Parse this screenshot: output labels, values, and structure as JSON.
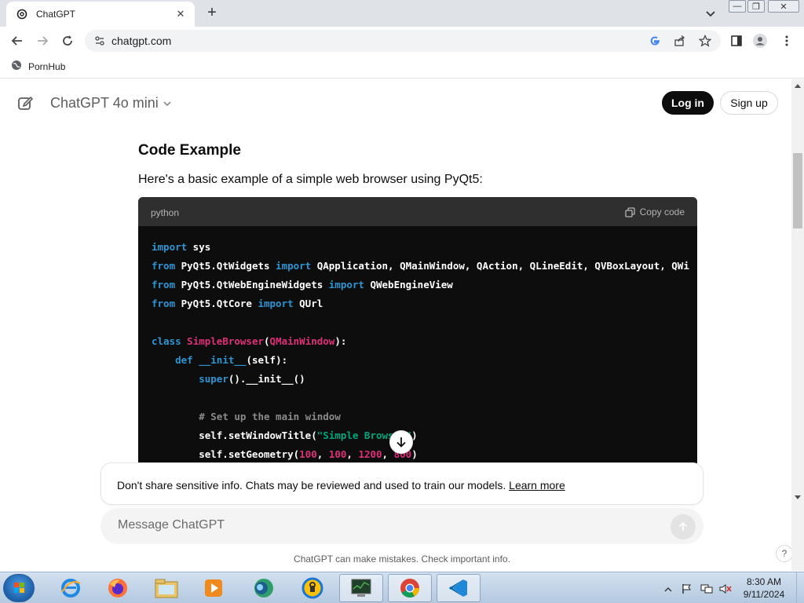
{
  "browser": {
    "tab_title": "ChatGPT",
    "url": "chatgpt.com",
    "bookmark_label": "PornHub"
  },
  "header": {
    "model_name": "ChatGPT 4o mini",
    "login_label": "Log in",
    "signup_label": "Sign up"
  },
  "content": {
    "heading": "Code Example",
    "paragraph": "Here's a basic example of a simple web browser using PyQt5:"
  },
  "code_block": {
    "language": "python",
    "copy_label": "Copy code",
    "lines": [
      [
        {
          "t": "import",
          "c": "kw"
        },
        {
          "t": " sys",
          "c": ""
        }
      ],
      [
        {
          "t": "from",
          "c": "kw"
        },
        {
          "t": " PyQt5.QtWidgets ",
          "c": ""
        },
        {
          "t": "import",
          "c": "kw"
        },
        {
          "t": " QApplication, QMainWindow, QAction, QLineEdit, QVBoxLayout, QWi",
          "c": ""
        }
      ],
      [
        {
          "t": "from",
          "c": "kw"
        },
        {
          "t": " PyQt5.QtWebEngineWidgets ",
          "c": ""
        },
        {
          "t": "import",
          "c": "kw"
        },
        {
          "t": " QWebEngineView",
          "c": ""
        }
      ],
      [
        {
          "t": "from",
          "c": "kw"
        },
        {
          "t": " PyQt5.QtCore ",
          "c": ""
        },
        {
          "t": "import",
          "c": "kw"
        },
        {
          "t": " QUrl",
          "c": ""
        }
      ],
      [],
      [
        {
          "t": "class",
          "c": "kw"
        },
        {
          "t": " ",
          "c": ""
        },
        {
          "t": "SimpleBrowser",
          "c": "cls"
        },
        {
          "t": "(",
          "c": ""
        },
        {
          "t": "QMainWindow",
          "c": "cls"
        },
        {
          "t": "):",
          "c": ""
        }
      ],
      [
        {
          "t": "    ",
          "c": ""
        },
        {
          "t": "def",
          "c": "kw"
        },
        {
          "t": " ",
          "c": ""
        },
        {
          "t": "__init__",
          "c": "kw"
        },
        {
          "t": "(self):",
          "c": ""
        }
      ],
      [
        {
          "t": "        ",
          "c": ""
        },
        {
          "t": "super",
          "c": "kw"
        },
        {
          "t": "().__init__()",
          "c": ""
        }
      ],
      [],
      [
        {
          "t": "        ",
          "c": ""
        },
        {
          "t": "# Set up the main window",
          "c": "cmt"
        }
      ],
      [
        {
          "t": "        self.setWindowTitle(",
          "c": ""
        },
        {
          "t": "\"Simple Browser\"",
          "c": "str"
        },
        {
          "t": ")",
          "c": ""
        }
      ],
      [
        {
          "t": "        self.setGeometry(",
          "c": ""
        },
        {
          "t": "100",
          "c": "num"
        },
        {
          "t": ", ",
          "c": ""
        },
        {
          "t": "100",
          "c": "num"
        },
        {
          "t": ", ",
          "c": ""
        },
        {
          "t": "1200",
          "c": "num"
        },
        {
          "t": ", ",
          "c": ""
        },
        {
          "t": "800",
          "c": "num"
        },
        {
          "t": ")",
          "c": ""
        }
      ]
    ]
  },
  "notice": {
    "text": "Don't share sensitive info. Chats may be reviewed and used to train our models. ",
    "link": "Learn more"
  },
  "composer": {
    "placeholder": "Message ChatGPT"
  },
  "footer": {
    "disclaimer": "ChatGPT can make mistakes. Check important info.",
    "help": "?"
  },
  "taskbar": {
    "time": "8:30 AM",
    "date": "9/11/2024",
    "apps": [
      "internet-explorer",
      "firefox",
      "file-explorer",
      "media-player",
      "browser-app",
      "security-app",
      "system-monitor",
      "chrome",
      "vscode"
    ]
  }
}
